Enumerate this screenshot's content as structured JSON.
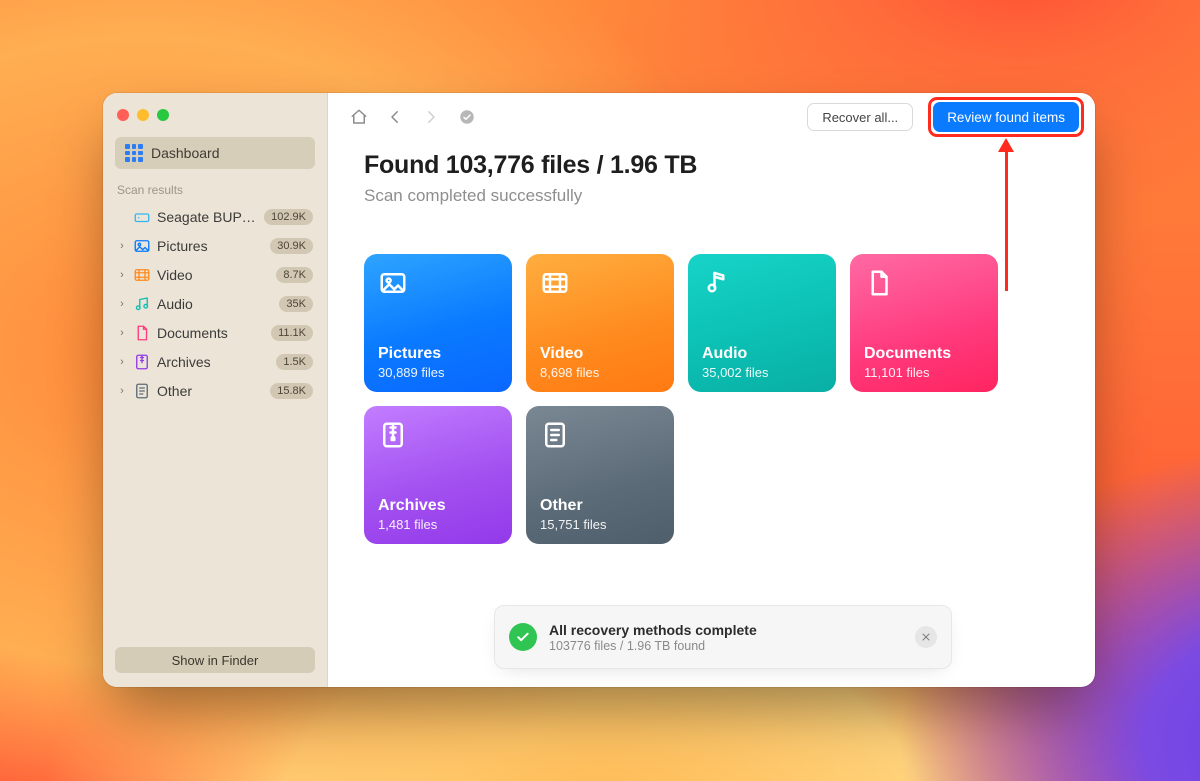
{
  "sidebar": {
    "dashboard_label": "Dashboard",
    "section_label": "Scan results",
    "items": [
      {
        "label": "Seagate BUP S…",
        "count": "102.9K",
        "icon": "drive",
        "expandable": false
      },
      {
        "label": "Pictures",
        "count": "30.9K",
        "icon": "picture",
        "expandable": true
      },
      {
        "label": "Video",
        "count": "8.7K",
        "icon": "video",
        "expandable": true
      },
      {
        "label": "Audio",
        "count": "35K",
        "icon": "audio",
        "expandable": true
      },
      {
        "label": "Documents",
        "count": "11.1K",
        "icon": "doc",
        "expandable": true
      },
      {
        "label": "Archives",
        "count": "1.5K",
        "icon": "archive",
        "expandable": true
      },
      {
        "label": "Other",
        "count": "15.8K",
        "icon": "other",
        "expandable": true
      }
    ],
    "footer_button": "Show in Finder"
  },
  "toolbar": {
    "recover_all_label": "Recover all...",
    "review_label": "Review found items"
  },
  "headline": {
    "title": "Found 103,776 files / 1.96 TB",
    "subtitle": "Scan completed successfully"
  },
  "cards": [
    {
      "title": "Pictures",
      "files": "30,889 files",
      "gradient": "g-blue",
      "icon": "picture"
    },
    {
      "title": "Video",
      "files": "8,698 files",
      "gradient": "g-orange",
      "icon": "video"
    },
    {
      "title": "Audio",
      "files": "35,002 files",
      "gradient": "g-teal",
      "icon": "audio"
    },
    {
      "title": "Documents",
      "files": "11,101 files",
      "gradient": "g-pink",
      "icon": "doc"
    },
    {
      "title": "Archives",
      "files": "1,481 files",
      "gradient": "g-purple",
      "icon": "archive"
    },
    {
      "title": "Other",
      "files": "15,751 files",
      "gradient": "g-slate",
      "icon": "other"
    }
  ],
  "notice": {
    "title": "All recovery methods complete",
    "subtitle": "103776 files / 1.96 TB found"
  },
  "icon_colors": {
    "drive": "#34b6f2",
    "picture": "#0a7aff",
    "video": "#ff8a1e",
    "audio": "#0cc0b4",
    "doc": "#ff3a7d",
    "archive": "#9339ea",
    "other": "#5c6b78"
  }
}
